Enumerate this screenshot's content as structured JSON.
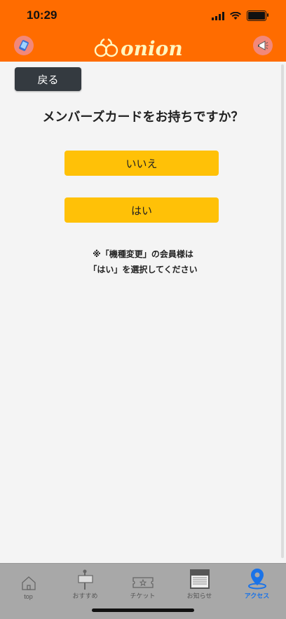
{
  "status": {
    "time": "10:29"
  },
  "header": {
    "logo_text": "onion"
  },
  "page": {
    "back_label": "戻る",
    "question": "メンバーズカードをお持ちですか？",
    "no_label": "いいえ",
    "yes_label": "はい",
    "note_line1": "※「機種変更」の会員様は",
    "note_line2": "「はい」を選択してください"
  },
  "tabs": [
    {
      "label": "top",
      "icon": "home-icon"
    },
    {
      "label": "おすすめ",
      "icon": "signpost-icon"
    },
    {
      "label": "チケット",
      "icon": "ticket-icon"
    },
    {
      "label": "お知らせ",
      "icon": "news-icon"
    },
    {
      "label": "アクセス",
      "icon": "map-pin-icon",
      "active": true
    }
  ],
  "colors": {
    "header": "#ff6c00",
    "accent": "#ffc107",
    "back_button": "#343a40",
    "active_tab": "#1a73e8"
  }
}
